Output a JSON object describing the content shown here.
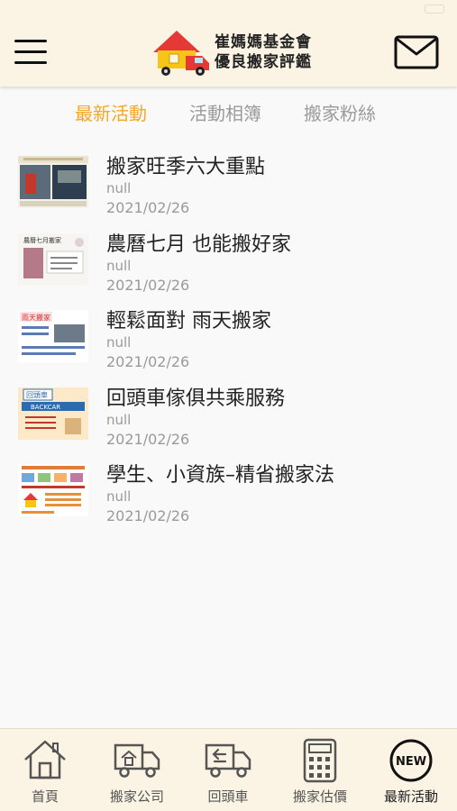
{
  "header": {
    "logo_line1": "崔媽媽基金會",
    "logo_line2": "優良搬家評鑑"
  },
  "tabs": [
    {
      "label": "最新活動",
      "active": true
    },
    {
      "label": "活動相簿",
      "active": false
    },
    {
      "label": "搬家粉絲",
      "active": false
    }
  ],
  "articles": [
    {
      "title": "搬家旺季六大重點",
      "subtitle": "null",
      "date": "2021/02/26"
    },
    {
      "title": "農曆七月 也能搬好家",
      "subtitle": "null",
      "date": "2021/02/26",
      "thumb_caption": "農曆七月搬家"
    },
    {
      "title": "輕鬆面對 雨天搬家",
      "subtitle": "null",
      "date": "2021/02/26",
      "thumb_caption": "雨天搬家"
    },
    {
      "title": "回頭車傢俱共乘服務",
      "subtitle": "null",
      "date": "2021/02/26",
      "thumb_caption": "回頭車",
      "thumb_caption2": "BACKCAR"
    },
    {
      "title": "學生、小資族–精省搬家法",
      "subtitle": "null",
      "date": "2021/02/26"
    }
  ],
  "bottom_nav": [
    {
      "label": "首頁",
      "icon": "home-icon"
    },
    {
      "label": "搬家公司",
      "icon": "moving-truck-icon"
    },
    {
      "label": "回頭車",
      "icon": "return-truck-icon"
    },
    {
      "label": "搬家估價",
      "icon": "calculator-icon"
    },
    {
      "label": "最新活動",
      "icon": "new-badge-icon",
      "active": true
    }
  ],
  "colors": {
    "accent": "#f5a623",
    "header_bg": "#fbf3e4",
    "muted_text": "#9a9a9a"
  }
}
